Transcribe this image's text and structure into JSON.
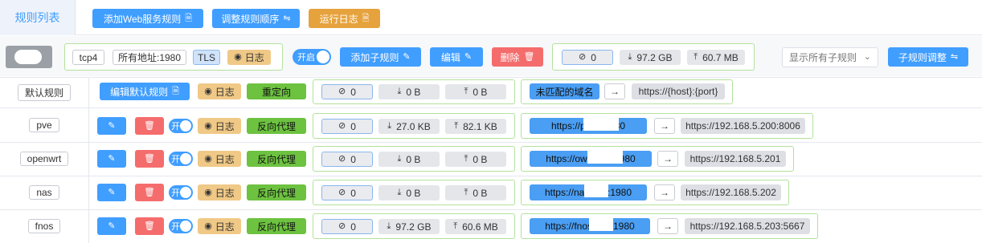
{
  "header": {
    "tab_label": "规则列表",
    "add_web_rule": "添加Web服务规则",
    "reorder_rules": "调整规则顺序",
    "run_log": "运行日志"
  },
  "listener": {
    "protocol": "tcp4",
    "address": "所有地址:1980",
    "tls": "TLS",
    "log": "日志",
    "toggle": "开启",
    "add_sub_rule": "添加子规则",
    "edit": "编辑",
    "delete": "删除",
    "connections": "0",
    "download": "97.2 GB",
    "upload": "60.7 MB",
    "filter_select": "显示所有子规则",
    "adjust_sub_rules": "子规则调整"
  },
  "default_rule": {
    "name": "默认规则",
    "edit_default": "编辑默认规则",
    "log": "日志",
    "action": "重定向",
    "connections": "0",
    "download": "0 B",
    "upload": "0 B",
    "match": "未匹配的域名",
    "arrow": "→",
    "target": "https://{host}:{port}"
  },
  "rules": [
    {
      "name": "pve",
      "toggle": "开",
      "log": "日志",
      "action": "反向代理",
      "connections": "0",
      "download": "27.0 KB",
      "upload": "82.1 KB",
      "source": "https://pve.      :1980",
      "arrow": "→",
      "target": "https://192.168.5.200:8006"
    },
    {
      "name": "openwrt",
      "toggle": "开",
      "log": "日志",
      "action": "反向代理",
      "connections": "0",
      "download": "0 B",
      "upload": "0 B",
      "source": "https://owrt.      .cn:1980",
      "arrow": "→",
      "target": "https://192.168.5.201"
    },
    {
      "name": "nas",
      "toggle": "开",
      "log": "日志",
      "action": "反向代理",
      "connections": "0",
      "download": "0 B",
      "upload": "0 B",
      "source": "https://nas.      .cn:1980",
      "arrow": "→",
      "target": "https://192.168.5.202"
    },
    {
      "name": "fnos",
      "toggle": "开",
      "log": "日志",
      "action": "反向代理",
      "connections": "0",
      "download": "97.2 GB",
      "upload": "60.6 MB",
      "source": "https://fnos.      .cn:1980",
      "arrow": "→",
      "target": "https://192.168.5.203:5667"
    }
  ],
  "colors": {
    "primary": "#409eff",
    "warning": "#e6a23c",
    "danger": "#f56c6c",
    "success": "#67c23a"
  }
}
